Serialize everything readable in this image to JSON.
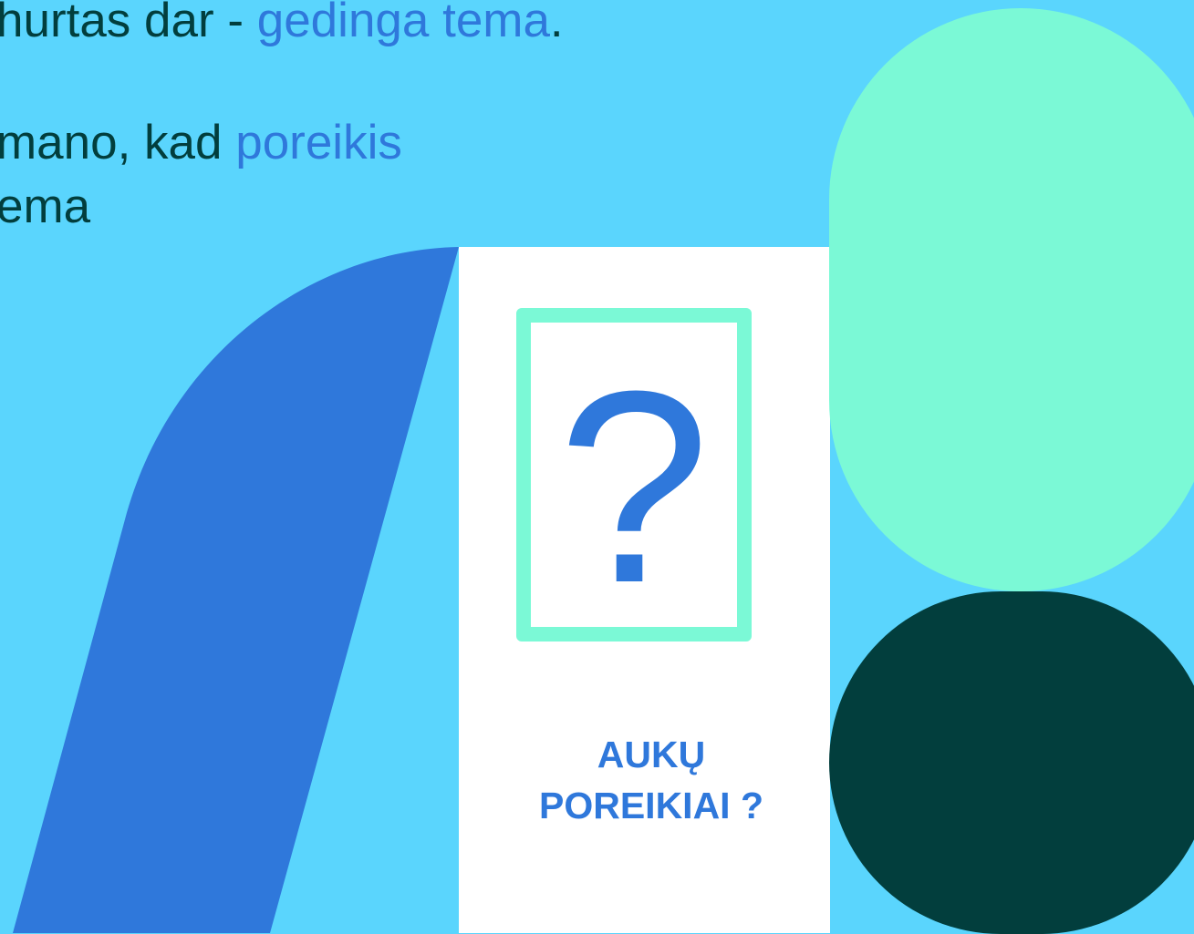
{
  "text_lines": {
    "line1": {
      "text": "hurtas dar - ",
      "highlight": "gedinga tema",
      "tail": "."
    },
    "line2": {
      "text": " mano, kad ",
      "highlight": "poreikis"
    },
    "line3": {
      "text": "ema"
    }
  },
  "card": {
    "symbol": "?",
    "caption_line1": "AUKŲ",
    "caption_line2": "POREIKIAI ?"
  },
  "colors": {
    "background": "#5ad5fd",
    "dark_text": "#023e3d",
    "accent_blue": "#2f78db",
    "mint": "#7bf9d6",
    "panel": "#ffffff"
  },
  "icons": {
    "question_mark": "question-mark-icon"
  }
}
